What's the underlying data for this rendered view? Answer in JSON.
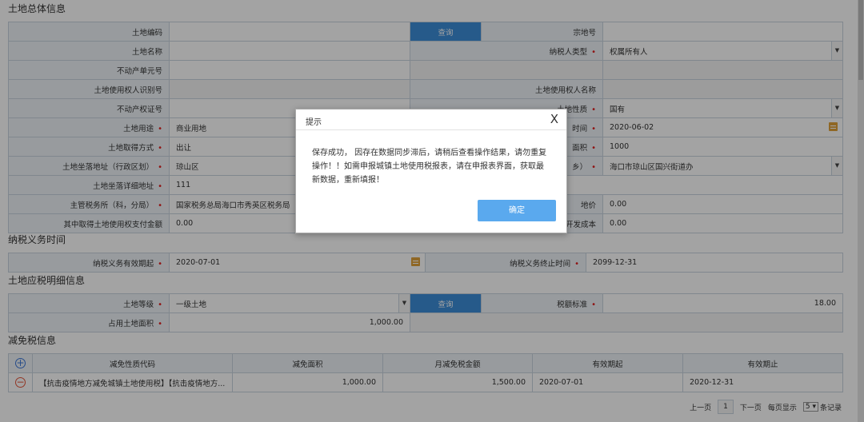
{
  "sections": {
    "overall": "土地总体信息",
    "duty_time": "纳税义务时间",
    "tax_detail": "土地应税明细信息",
    "relief": "减免税信息"
  },
  "query_label": "查询",
  "overall": {
    "land_code_label": "土地编码",
    "parcel_no_label": "宗地号",
    "land_name_label": "土地名称",
    "taxpayer_type_label": "纳税人类型",
    "taxpayer_type_value": "权属所有人",
    "property_unit_label": "不动产单元号",
    "user_id_label": "土地使用权人识别号",
    "user_name_label": "土地使用权人名称",
    "property_cert_label": "不动产权证号",
    "land_nature_label": "土地性质",
    "land_nature_value": "国有",
    "land_use_label": "土地用途",
    "land_use_value": "商业用地",
    "acquire_time_label": "时间",
    "acquire_time_value": "2020-06-02",
    "acquire_method_label": "土地取得方式",
    "acquire_method_value": "出让",
    "area_label": "面积",
    "area_value": "1000",
    "location_label": "土地坐落地址（行政区划）",
    "location_value": "琼山区",
    "street_label": "乡）",
    "street_value": "海口市琼山区国兴街道办",
    "detail_addr_label": "土地坐落详细地址",
    "detail_addr_value": "111",
    "tax_office_label": "主管税务所（科，分局）",
    "tax_office_value": "国家税务总局海口市秀英区税务局",
    "land_price_label": "地价",
    "land_price_value": "0.00",
    "use_fee_label": "其中取得土地使用权支付金额",
    "use_fee_value": "0.00",
    "dev_cost_label": "开发成本",
    "dev_cost_value": "0.00"
  },
  "duty": {
    "start_label": "纳税义务有效期起",
    "start_value": "2020-07-01",
    "end_label": "纳税义务终止时间",
    "end_value": "2099-12-31"
  },
  "detail": {
    "grade_label": "土地等级",
    "grade_value": "一级土地",
    "tax_std_label": "税额标准",
    "tax_std_value": "18.00",
    "occupied_label": "占用土地面积",
    "occupied_value": "1,000.00"
  },
  "relief": {
    "columns": [
      "减免性质代码",
      "减免面积",
      "月减免税金额",
      "有效期起",
      "有效期止"
    ],
    "rows": [
      {
        "code": "【抗击疫情地方减免城镇土地使用税】【抗击疫情地方...",
        "area": "1,000.00",
        "amount": "1,500.00",
        "start": "2020-07-01",
        "end": "2020-12-31"
      }
    ]
  },
  "pager": {
    "prev": "上一页",
    "current": "1",
    "next": "下一页",
    "per_page_prefix": "每页显示",
    "per_page": "5",
    "per_page_suffix": "条记录"
  },
  "dialog": {
    "title": "提示",
    "close": "X",
    "message": "保存成功，  因存在数据同步滞后，请稍后查看操作结果，请勿重复操作！！如需申报城镇土地使用税报表，请在申报表界面，获取最新数据，重新填报！",
    "ok": "确定"
  },
  "colors": {
    "accent": "#3c8dd8",
    "required": "#e02020",
    "label_bg": "#eef3f8"
  },
  "icons": [
    "dropdown-arrow-icon",
    "calendar-icon",
    "add-row-icon",
    "remove-row-icon",
    "close-icon"
  ]
}
